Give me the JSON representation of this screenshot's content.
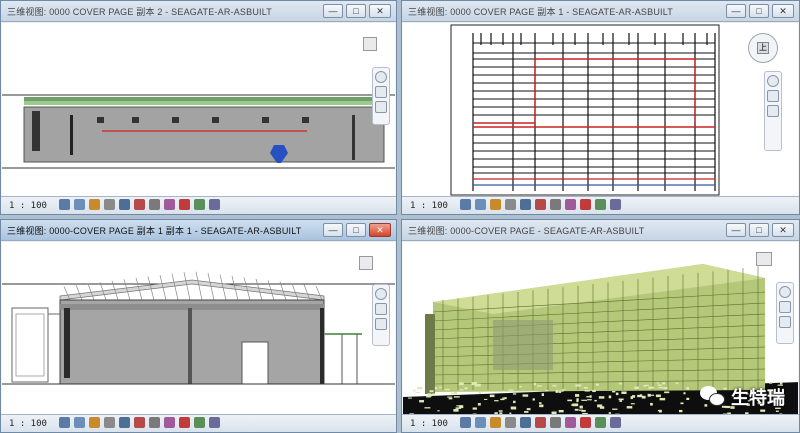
{
  "windows": [
    {
      "id": "w1",
      "title": "三维视图: 0000 COVER PAGE 副本 2 - SEAGATE-AR-ASBUILT",
      "active": false
    },
    {
      "id": "w2",
      "title": "三维视图: 0000 COVER PAGE 副本 1 - SEAGATE-AR-ASBUILT",
      "active": false
    },
    {
      "id": "w3",
      "title": "三维视图: 0000-COVER PAGE 副本 1 副本 1 - SEAGATE-AR-ASBUILT",
      "active": true
    },
    {
      "id": "w4",
      "title": "三维视图: 0000-COVER PAGE - SEAGATE-AR-ASBUILT",
      "active": false
    }
  ],
  "status": {
    "scale": "1 : 100"
  },
  "controls": {
    "minimize": "—",
    "maximize": "□",
    "close": "✕"
  },
  "viewcube_label": "上",
  "watermark": {
    "text": "生特瑞"
  },
  "icons": [
    "detail-level-icon",
    "visual-style-icon",
    "sun-path-icon",
    "shadows-icon",
    "crop-icon",
    "show-crop-icon",
    "lock-view-icon",
    "temp-hide-icon",
    "reveal-icon",
    "analysis-icon",
    "render-icon"
  ],
  "icon_colors": [
    "#5b7aa5",
    "#6b8fb8",
    "#c98a2a",
    "#8a8a8a",
    "#4e6f95",
    "#b54a4a",
    "#7a7a7a",
    "#a05a9a",
    "#c23b3b",
    "#5a8f5a",
    "#6b6b9b"
  ]
}
